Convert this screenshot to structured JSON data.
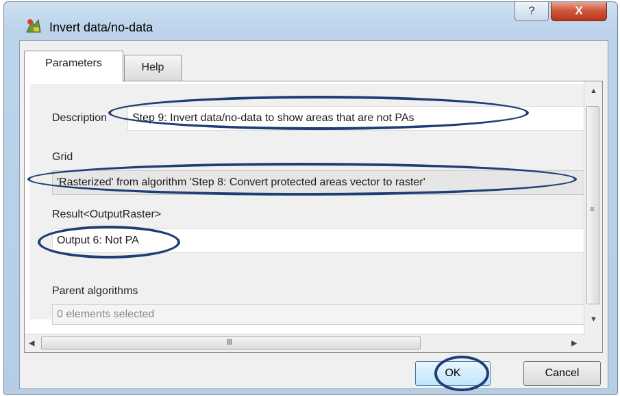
{
  "window": {
    "title": "Invert data/no-data",
    "help_button": "?",
    "close_button": "X",
    "app_icon": "qgis-processing-icon"
  },
  "tabs": [
    {
      "label": "Parameters",
      "selected": true
    },
    {
      "label": "Help",
      "selected": false
    }
  ],
  "form": {
    "description_label": "Description",
    "description_value": "Step 9: Invert data/no-data to show areas that are not PAs",
    "grid_label": "Grid",
    "grid_value": "'Rasterized' from algorithm 'Step 8: Convert protected areas vector to raster'",
    "result_label": "Result<OutputRaster>",
    "result_value": "Output 6: Not PA",
    "parent_label": "Parent algorithms",
    "parent_placeholder": "0 elements selected"
  },
  "scrollbars": {
    "up_arrow": "▲",
    "down_arrow": "▼",
    "left_arrow": "◀",
    "right_arrow": "▶",
    "v_grip": "≡",
    "h_grip": "III"
  },
  "buttons": {
    "ok": "OK",
    "cancel": "Cancel"
  },
  "colors": {
    "annotation": "#1f3f74",
    "close_button": "#c8452a",
    "ok_border": "#3c7fb1"
  }
}
